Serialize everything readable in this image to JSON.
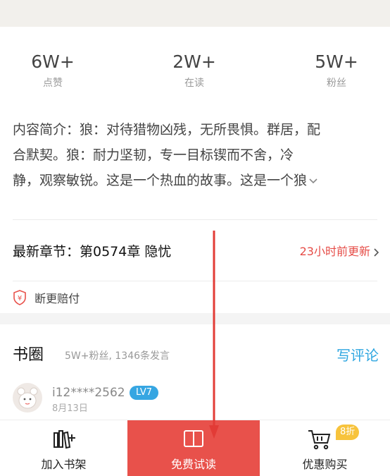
{
  "stats": [
    {
      "value": "6W+",
      "label": "点赞"
    },
    {
      "value": "2W+",
      "label": "在读"
    },
    {
      "value": "5W+",
      "label": "粉丝"
    }
  ],
  "intro": {
    "line1": "内容简介：狼：对待猎物凶残，无所畏惧。群居，配",
    "line2": "合默契。狼：耐力坚韧，专一目标锲而不舍，冷",
    "line3": "静，观察敏锐。这是一个热血的故事。这是一个狼"
  },
  "latest_chapter": {
    "title": "最新章节：第0574章  隐忧",
    "updated": "23小时前更新"
  },
  "guarantee": {
    "text": "断更赔付",
    "icon": "yen-shield-icon"
  },
  "book_circle": {
    "title": "书圈",
    "summary": "5W+粉丝, 1346条发言",
    "write_comment": "写评论"
  },
  "comment": {
    "user": "i12****2562",
    "level": "LV7",
    "date": "8月13日"
  },
  "bottom_bar": {
    "add_shelf": "加入书架",
    "free_read": "免费试读",
    "discount_buy": "优惠购买",
    "discount_badge": "8折"
  },
  "colors": {
    "accent_red": "#e8514b",
    "link_blue": "#2ea6e0",
    "level_blue": "#36a6e2",
    "badge_yellow": "#f7c33c"
  }
}
